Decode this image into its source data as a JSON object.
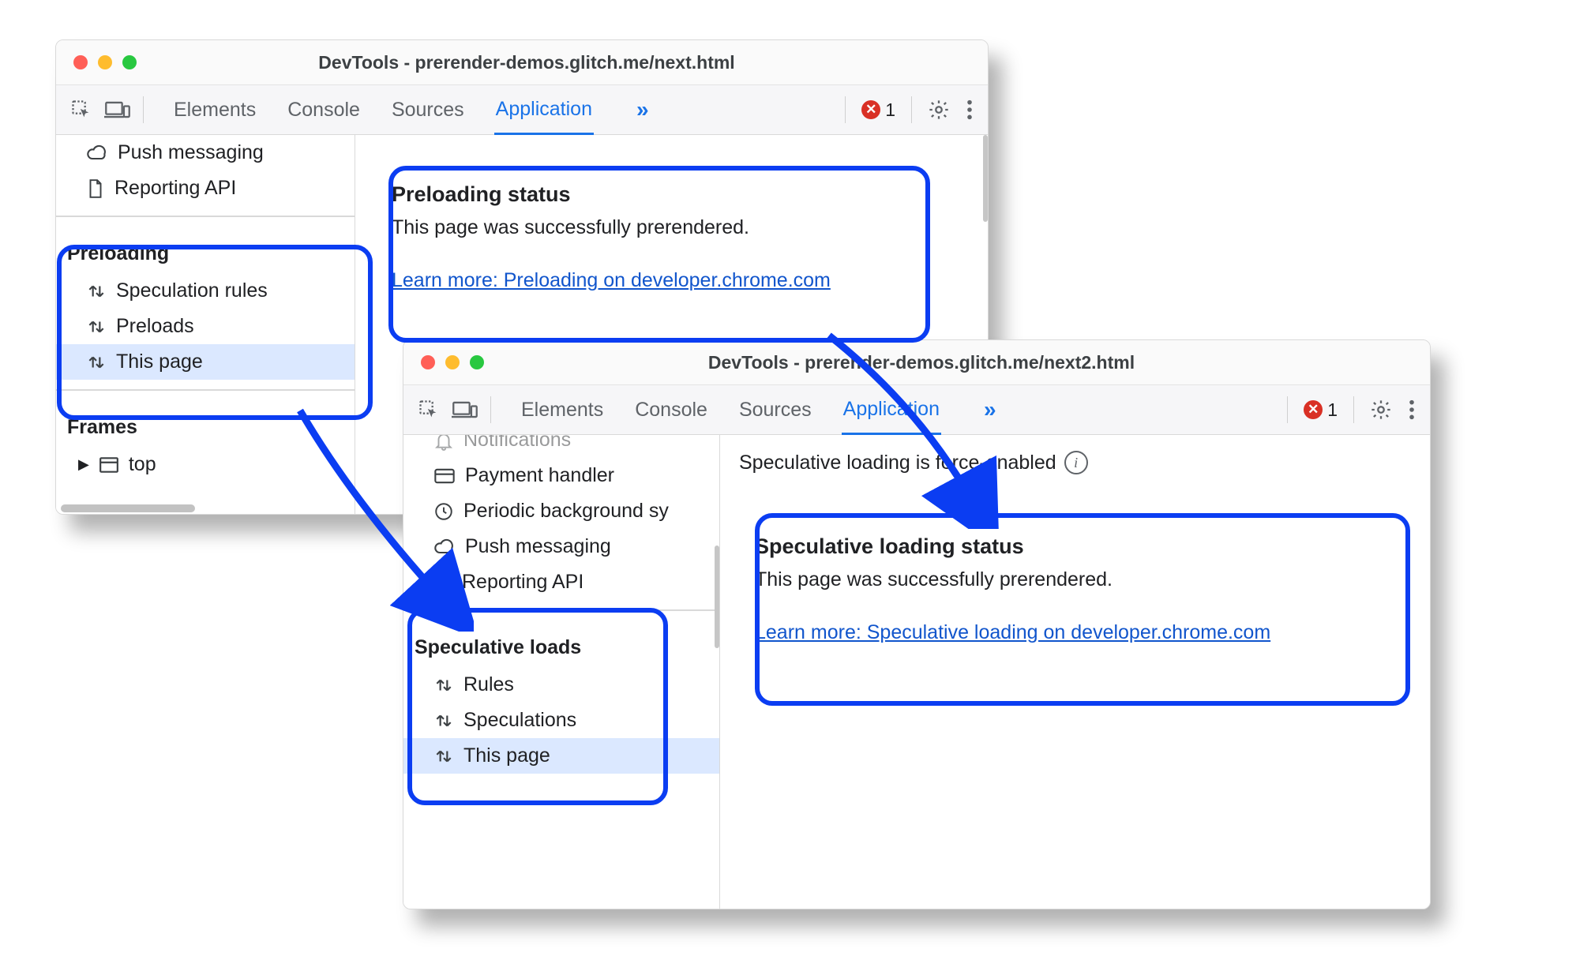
{
  "win1": {
    "title": "DevTools - prerender-demos.glitch.me/next.html",
    "tabs": [
      "Elements",
      "Console",
      "Sources",
      "Application"
    ],
    "active_tab": 3,
    "error_count": "1",
    "sidebar": {
      "items_top": [
        {
          "icon": "cloud",
          "label": "Push messaging"
        },
        {
          "icon": "doc",
          "label": "Reporting API"
        }
      ],
      "group1": "Preloading",
      "group1_items": [
        {
          "label": "Speculation rules"
        },
        {
          "label": "Preloads"
        },
        {
          "label": "This page",
          "sel": true
        }
      ],
      "group2": "Frames",
      "group2_items": [
        {
          "label": "top"
        }
      ]
    },
    "status": {
      "heading": "Preloading status",
      "body": "This page was successfully prerendered.",
      "link": "Learn more: Preloading on developer.chrome.com"
    }
  },
  "win2": {
    "title": "DevTools - prerender-demos.glitch.me/next2.html",
    "tabs": [
      "Elements",
      "Console",
      "Sources",
      "Application"
    ],
    "active_tab": 3,
    "error_count": "1",
    "notice": "Speculative loading is force-enabled",
    "sidebar": {
      "items_top": [
        {
          "icon": "bell",
          "label": "Notifications",
          "faded": true
        },
        {
          "icon": "card",
          "label": "Payment handler"
        },
        {
          "icon": "clock",
          "label": "Periodic background sy"
        },
        {
          "icon": "cloud",
          "label": "Push messaging"
        },
        {
          "icon": "doc",
          "label": "Reporting API"
        }
      ],
      "group1": "Speculative loads",
      "group1_items": [
        {
          "label": "Rules"
        },
        {
          "label": "Speculations"
        },
        {
          "label": "This page",
          "sel": true
        }
      ]
    },
    "status": {
      "heading": "Speculative loading status",
      "body": "This page was successfully prerendered.",
      "link": "Learn more: Speculative loading on developer.chrome.com"
    }
  }
}
